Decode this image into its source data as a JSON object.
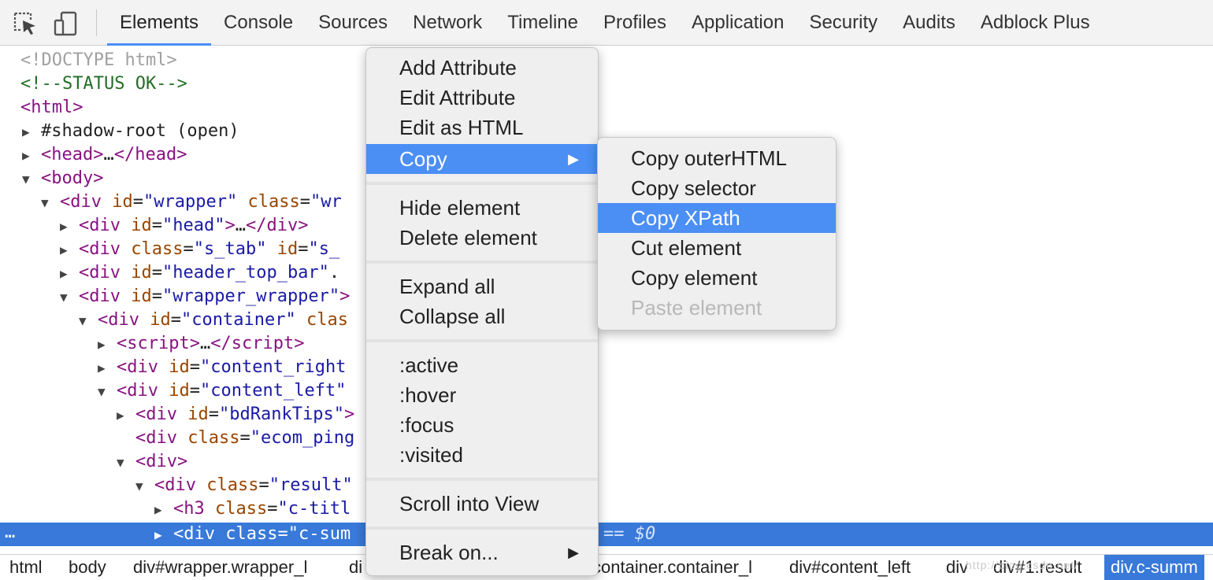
{
  "toolbar": {
    "tabs": [
      "Elements",
      "Console",
      "Sources",
      "Network",
      "Timeline",
      "Profiles",
      "Application",
      "Security",
      "Audits",
      "Adblock Plus"
    ],
    "active_tab": "Elements"
  },
  "tree": {
    "doctype": "<!DOCTYPE html>",
    "comment": "<!--STATUS OK-->",
    "rows": {
      "html_open": "html",
      "shadow_root": "#shadow-root (open)",
      "head_tag": "head",
      "head_ellipsis": "…",
      "body_tag": "body",
      "wrapper_tag": "div",
      "wrapper_id_attr": "id",
      "wrapper_id_val": "\"wrapper\"",
      "wrapper_class_attr": "class",
      "wrapper_class_val": "\"wr",
      "head_div_id_val": "\"head\"",
      "head_div_rest": "…",
      "stab_class_val": "\"s_tab\"",
      "stab_id_val": "\"s_",
      "htb_id_val": "\"header_top_bar\"",
      "htb_rest": ".",
      "ww_id_val": "\"wrapper_wrapper\"",
      "ww_rest": ">",
      "cont_id_val": "\"container\"",
      "cont_class_attr": "clas",
      "script_tag": "script",
      "script_rest": "…",
      "cr_id_val": "\"content_right",
      "cl_id_val": "\"content_left\"",
      "brt_id_val": "\"bdRankTips\"",
      "brt_rest": ">",
      "ecom_class_val": "\"ecom_ping",
      "div_tag": "div",
      "result_class_val": "\"result\"",
      "h3_tag": "h3",
      "h3_class_val": "\"c-titl",
      "sel_class_val": "\"c-sum",
      "sel_eq": "== $0",
      "sel_dots": "…"
    }
  },
  "breadcrumb": [
    "html",
    "body",
    "div#wrapper.wrapper_l",
    "di",
    "container.container_l",
    "div#content_left",
    "div",
    "div#1.result"
  ],
  "breadcrumb_active": "div.c-summ",
  "watermark": "http://blog.csdn.net/",
  "menu_main": {
    "items": [
      "Add Attribute",
      "Edit Attribute",
      "Edit as HTML",
      "Copy",
      "Hide element",
      "Delete element",
      "Expand all",
      "Collapse all",
      ":active",
      ":hover",
      ":focus",
      ":visited",
      "Scroll into View",
      "Break on..."
    ],
    "highlighted": "Copy"
  },
  "menu_copy": {
    "items": [
      "Copy outerHTML",
      "Copy selector",
      "Copy XPath",
      "Cut element",
      "Copy element",
      "Paste element"
    ],
    "highlighted": "Copy XPath",
    "disabled": "Paste element"
  },
  "icons": {
    "inspect": "inspect-element-icon",
    "device": "device-toggle-icon",
    "submenu": "chevron-right-icon"
  },
  "colors": {
    "accent": "#4b8ff5",
    "selection": "#3879d9"
  }
}
